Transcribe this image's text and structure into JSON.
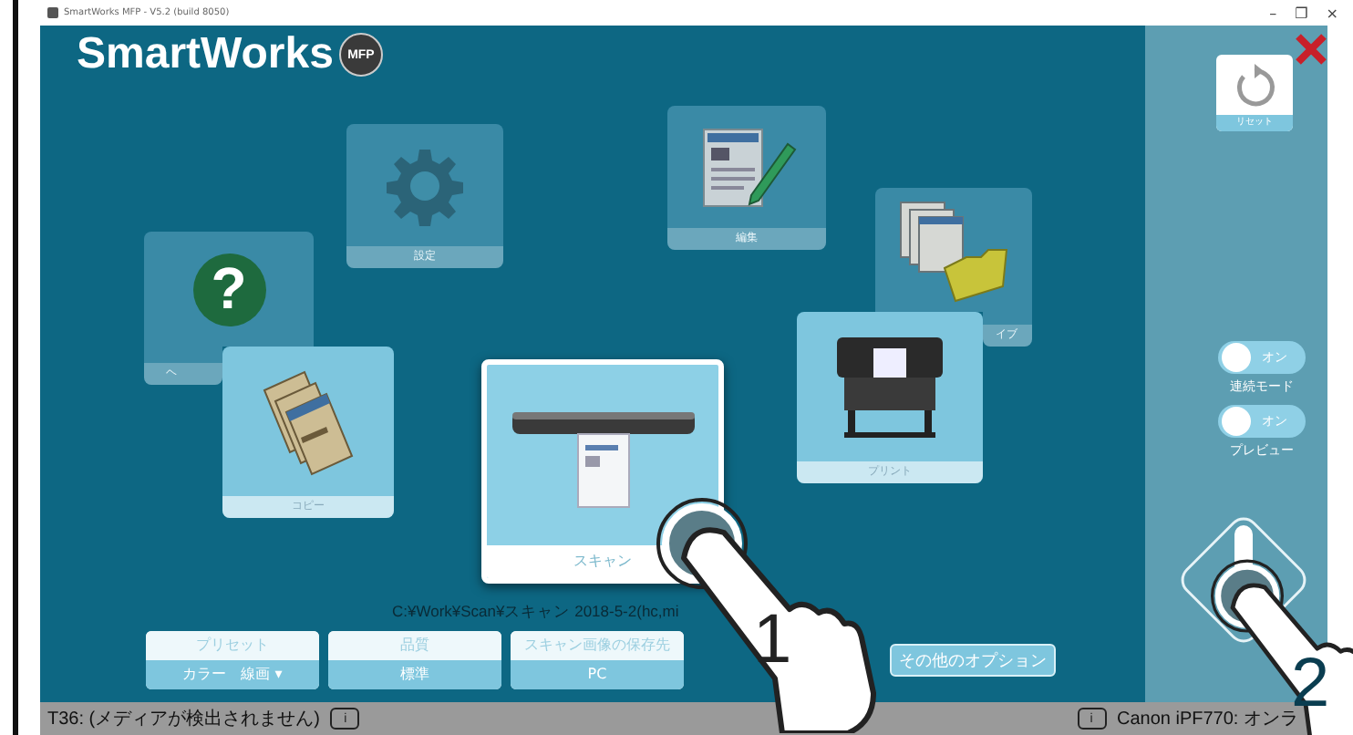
{
  "window": {
    "title": "SmartWorks MFP - V5.2 (build 8050)",
    "controls": [
      "–",
      "❐",
      "×"
    ]
  },
  "logo": {
    "text": "SmartWorks",
    "badge": "MFP"
  },
  "tiles": [
    {
      "kind": "help",
      "label": "ヘ",
      "glyph": "?",
      "selected": false
    },
    {
      "kind": "settings",
      "label": "設定",
      "selected": false
    },
    {
      "kind": "edit",
      "label": "編集",
      "selected": false
    },
    {
      "kind": "archive",
      "label": "イブ",
      "selected": false
    },
    {
      "kind": "copy",
      "label": "コピー",
      "selected": false
    },
    {
      "kind": "print",
      "label": "プリント",
      "selected": false
    },
    {
      "kind": "scan",
      "label": "スキャン",
      "selected": true
    }
  ],
  "output_path": "C:¥Work¥Scan¥スキャン 2018-5-2(hc,mi",
  "options": [
    {
      "title": "プリセット",
      "value": "カラー　線画 ▾"
    },
    {
      "title": "品質",
      "value": "標準"
    },
    {
      "title": "スキャン画像の保存先",
      "value": "PC"
    }
  ],
  "more_button": "その他のオプション",
  "sidebar": {
    "reset": "リセット",
    "toggles": [
      {
        "label": "連続モード",
        "state_text": "オン",
        "on": true
      },
      {
        "label": "プレビュー",
        "state_text": "オン",
        "on": true
      }
    ]
  },
  "status_bar": {
    "message": "T36: (メディアが検出されません)",
    "info": "i",
    "printer_info": "i",
    "printer": "Canon iPF770: オンラ"
  },
  "annotations": [
    {
      "number": "1"
    },
    {
      "number": "2"
    }
  ]
}
